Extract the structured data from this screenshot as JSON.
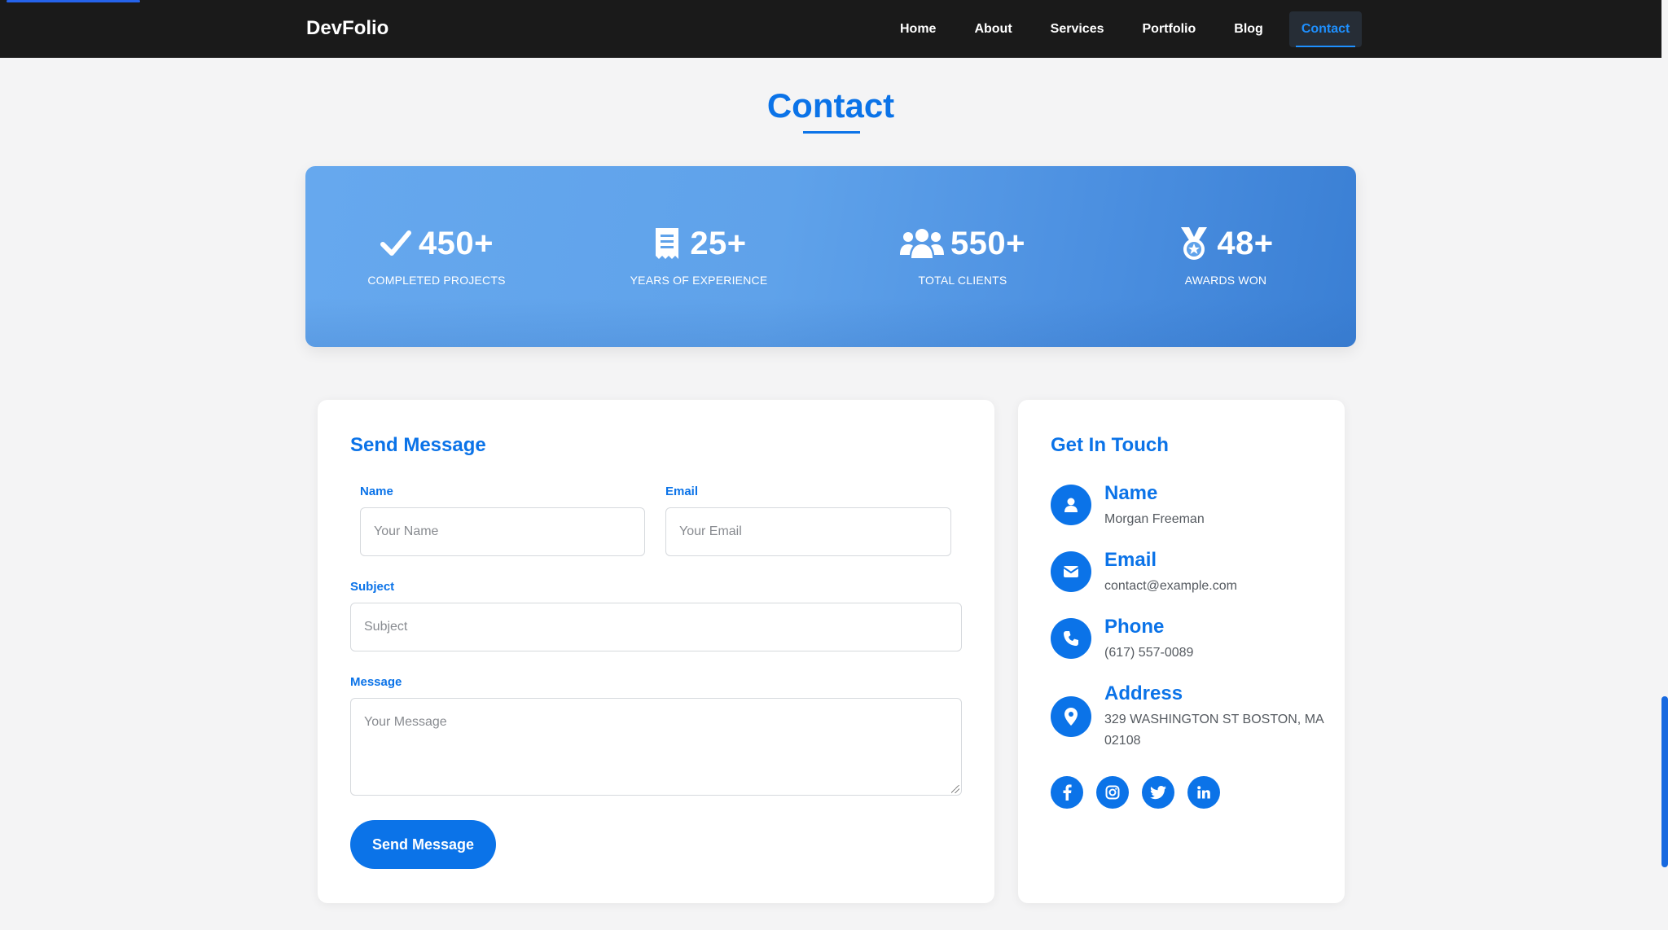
{
  "brand": "DevFolio",
  "nav": {
    "items": [
      "Home",
      "About",
      "Services",
      "Portfolio",
      "Blog",
      "Contact"
    ],
    "active": "Contact"
  },
  "section_title": "Contact",
  "stats": [
    {
      "icon": "check-icon",
      "value": "450+",
      "label": "COMPLETED PROJECTS"
    },
    {
      "icon": "document-icon",
      "value": "25+",
      "label": "YEARS OF EXPERIENCE"
    },
    {
      "icon": "users-icon",
      "value": "550+",
      "label": "TOTAL CLIENTS"
    },
    {
      "icon": "medal-icon",
      "value": "48+",
      "label": "AWARDS WON"
    }
  ],
  "form": {
    "heading": "Send Message",
    "name_label": "Name",
    "name_placeholder": "Your Name",
    "email_label": "Email",
    "email_placeholder": "Your Email",
    "subject_label": "Subject",
    "subject_placeholder": "Subject",
    "message_label": "Message",
    "message_placeholder": "Your Message",
    "submit_label": "Send Message"
  },
  "info": {
    "heading": "Get In Touch",
    "items": [
      {
        "icon": "user-icon",
        "title": "Name",
        "value": "Morgan Freeman"
      },
      {
        "icon": "envelope-icon",
        "title": "Email",
        "value": "contact@example.com"
      },
      {
        "icon": "phone-icon",
        "title": "Phone",
        "value": "(617) 557-0089"
      },
      {
        "icon": "map-pin-icon",
        "title": "Address",
        "value": "329 WASHINGTON ST BOSTON, MA 02108"
      }
    ],
    "socials": [
      "facebook-icon",
      "instagram-icon",
      "twitter-icon",
      "linkedin-icon"
    ]
  },
  "colors": {
    "accent": "#0b73e8",
    "navbar": "#1a1a1a",
    "page_background": "#f4f4f5",
    "nav_active": "#1e90ff"
  }
}
